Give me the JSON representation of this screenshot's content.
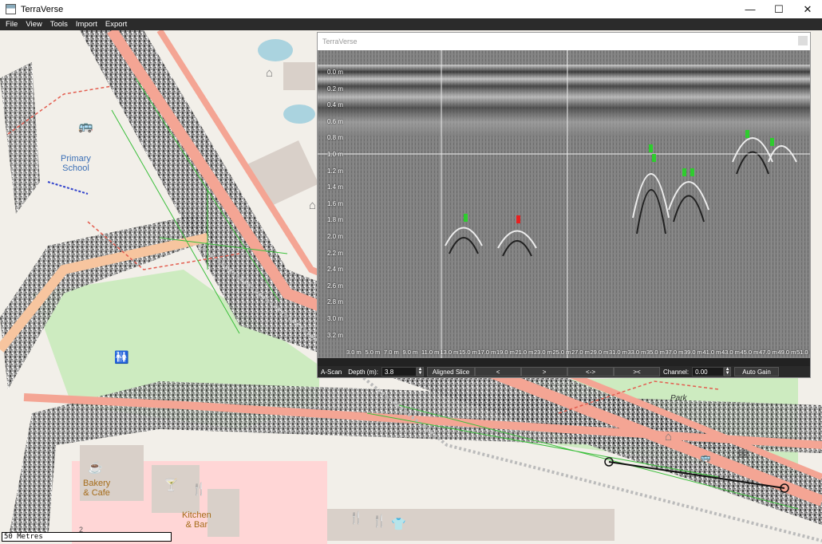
{
  "window": {
    "title": "TerraVerse",
    "minimize_glyph": "—",
    "maximize_glyph": "☐",
    "close_glyph": "✕"
  },
  "menu": [
    "File",
    "View",
    "Tools",
    "Import",
    "Export"
  ],
  "map": {
    "labels": {
      "primary_school": "Primary\nSchool",
      "park": "Park",
      "bakery": "Bakery\n& Cafe",
      "kitchen": "Kitchen\n& Bar",
      "number_2": "2"
    },
    "scale": "50 Metres",
    "colors": {
      "background": "#f2efe9",
      "road": "#f4a594",
      "green": "#cdebc0",
      "path": "#e35d4f"
    }
  },
  "radar_panel": {
    "title": "TerraVerse",
    "depth_ticks": [
      "0.0 m",
      "0.2 m",
      "0.4 m",
      "0.6 m",
      "0.8 m",
      "1.0 m",
      "1.2 m",
      "1.4 m",
      "1.6 m",
      "1.8 m",
      "2.0 m",
      "2.2 m",
      "2.4 m",
      "2.6 m",
      "2.8 m",
      "3.0 m",
      "3.2 m"
    ],
    "distance_ticks": [
      "3.0 m",
      "5.0 m",
      "7.0 m",
      "9.0 m",
      "11.0 m",
      "13.0 m",
      "15.0 m",
      "17.0 m",
      "19.0 m",
      "21.0 m",
      "23.0 m",
      "25.0 m",
      "27.0 m",
      "29.0 m",
      "31.0 m",
      "33.0 m",
      "35.0 m",
      "37.0 m",
      "39.0 m",
      "41.0 m",
      "43.0 m",
      "45.0 m",
      "47.0 m",
      "49.0 m",
      "51.0 m"
    ],
    "controls": {
      "ascan": "A-Scan",
      "depth_label": "Depth (m):",
      "depth_value": "3.8",
      "aligned_slice": "Aligned Slice",
      "prev": "<",
      "next": ">",
      "expand": "<->",
      "contract": "><",
      "channel_label": "Channel:",
      "channel_value": "0.00",
      "auto_gain": "Auto Gain"
    }
  }
}
